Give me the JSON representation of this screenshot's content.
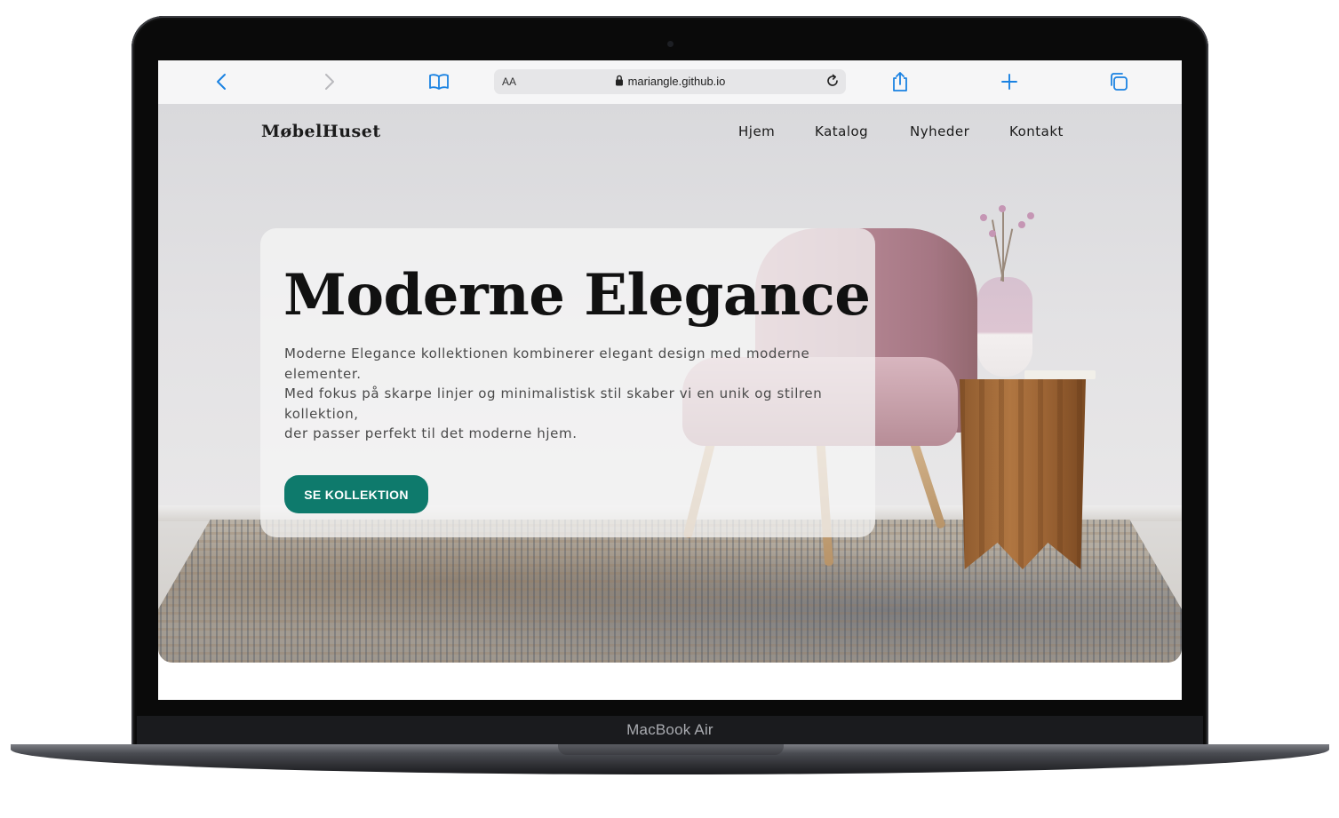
{
  "device": {
    "model_label": "MacBook Air"
  },
  "browser": {
    "address_bar": {
      "text_size_label": "AA",
      "url": "mariangle.github.io"
    },
    "icons": [
      "back-icon",
      "forward-icon",
      "bookmarks-icon",
      "lock-icon",
      "reload-icon",
      "share-icon",
      "new-tab-icon",
      "tabs-icon"
    ]
  },
  "site": {
    "logo": "MøbelHuset",
    "nav": {
      "items": [
        {
          "label": "Hjem"
        },
        {
          "label": "Katalog"
        },
        {
          "label": "Nyheder"
        },
        {
          "label": "Kontakt"
        }
      ]
    },
    "hero": {
      "title": "Moderne Elegance",
      "description_lines": [
        "Moderne Elegance kollektionen kombinerer elegant design med moderne elementer.",
        "Med fokus på skarpe linjer og minimalistisk stil skaber vi en unik og stilren kollektion,",
        "der passer perfekt til det moderne hjem."
      ],
      "cta_label": "SE KOLLEKTION"
    }
  },
  "colors": {
    "accent": "#0e7a6c",
    "browser_accent": "#1a82e2",
    "text_dark": "#111111",
    "text_body": "#4a4a4a"
  }
}
